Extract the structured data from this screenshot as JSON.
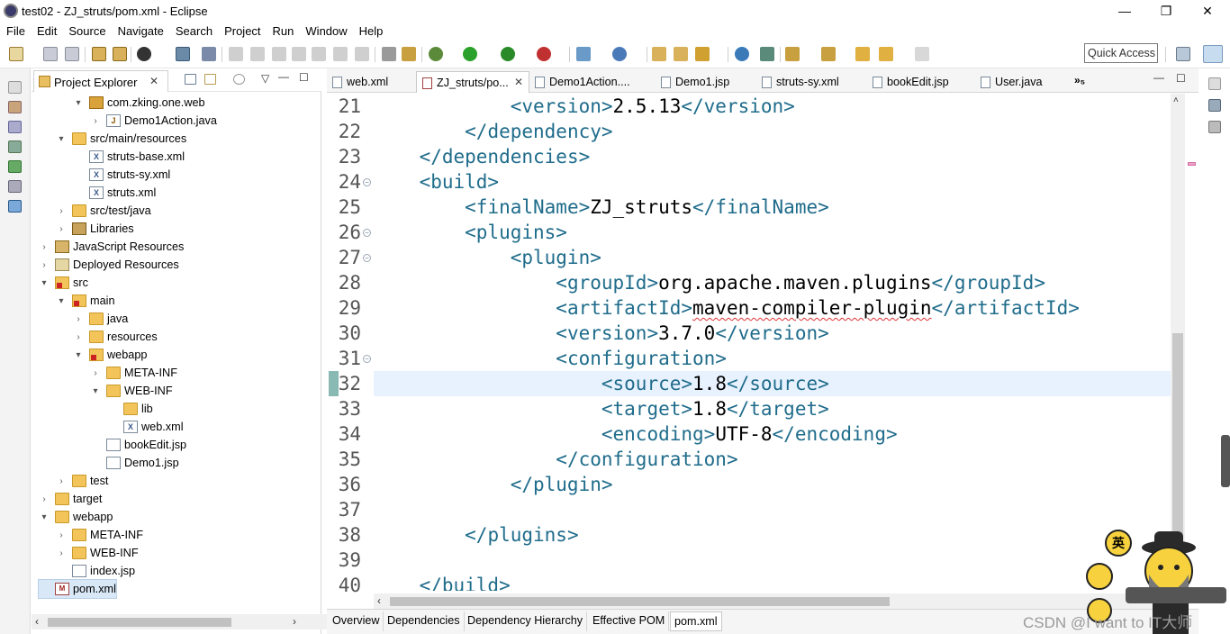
{
  "window": {
    "title": "test02 - ZJ_struts/pom.xml - Eclipse",
    "minimize": "—",
    "maximize": "❐",
    "close": "✕"
  },
  "menu": [
    "File",
    "Edit",
    "Source",
    "Navigate",
    "Search",
    "Project",
    "Run",
    "Window",
    "Help"
  ],
  "toolbar": {
    "quick_access": "Quick Access"
  },
  "project_explorer": {
    "title": "Project Explorer",
    "close": "✕",
    "tree": [
      {
        "label": "com.zking.one.web",
        "icon": "package-icon",
        "depth": 3,
        "arrow": "▾"
      },
      {
        "label": "Demo1Action.java",
        "icon": "java-file-icon",
        "depth": 4,
        "arrow": "›"
      },
      {
        "label": "src/main/resources",
        "icon": "source-folder-icon",
        "depth": 2,
        "arrow": "▾"
      },
      {
        "label": "struts-base.xml",
        "icon": "xml-file-icon",
        "depth": 3,
        "arrow": ""
      },
      {
        "label": "struts-sy.xml",
        "icon": "xml-file-icon",
        "depth": 3,
        "arrow": ""
      },
      {
        "label": "struts.xml",
        "icon": "xml-file-icon",
        "depth": 3,
        "arrow": ""
      },
      {
        "label": "src/test/java",
        "icon": "source-folder-icon",
        "depth": 2,
        "arrow": "›"
      },
      {
        "label": "Libraries",
        "icon": "library-icon",
        "depth": 2,
        "arrow": "›"
      },
      {
        "label": "JavaScript Resources",
        "icon": "javascript-icon",
        "depth": 1,
        "arrow": "›"
      },
      {
        "label": "Deployed Resources",
        "icon": "deployed-icon",
        "depth": 1,
        "arrow": "›"
      },
      {
        "label": "src",
        "icon": "error-folder-icon",
        "depth": 1,
        "arrow": "▾"
      },
      {
        "label": "main",
        "icon": "error-folder-icon",
        "depth": 2,
        "arrow": "▾"
      },
      {
        "label": "java",
        "icon": "folder-icon",
        "depth": 3,
        "arrow": "›"
      },
      {
        "label": "resources",
        "icon": "folder-icon",
        "depth": 3,
        "arrow": "›"
      },
      {
        "label": "webapp",
        "icon": "error-folder-icon",
        "depth": 3,
        "arrow": "▾"
      },
      {
        "label": "META-INF",
        "icon": "folder-icon",
        "depth": 4,
        "arrow": "›"
      },
      {
        "label": "WEB-INF",
        "icon": "folder-icon",
        "depth": 4,
        "arrow": "▾"
      },
      {
        "label": "lib",
        "icon": "folder-icon",
        "depth": 5,
        "arrow": ""
      },
      {
        "label": "web.xml",
        "icon": "xml-file-icon",
        "depth": 5,
        "arrow": ""
      },
      {
        "label": "bookEdit.jsp",
        "icon": "jsp-file-icon",
        "depth": 4,
        "arrow": ""
      },
      {
        "label": "Demo1.jsp",
        "icon": "error-jsp-icon",
        "depth": 4,
        "arrow": ""
      },
      {
        "label": "test",
        "icon": "folder-icon",
        "depth": 2,
        "arrow": "›"
      },
      {
        "label": "target",
        "icon": "folder-icon",
        "depth": 1,
        "arrow": "›"
      },
      {
        "label": "webapp",
        "icon": "folder-icon",
        "depth": 1,
        "arrow": "▾"
      },
      {
        "label": "META-INF",
        "icon": "folder-icon",
        "depth": 2,
        "arrow": "›"
      },
      {
        "label": "WEB-INF",
        "icon": "folder-icon",
        "depth": 2,
        "arrow": "›"
      },
      {
        "label": "index.jsp",
        "icon": "jsp-file-icon",
        "depth": 2,
        "arrow": ""
      },
      {
        "label": "pom.xml",
        "icon": "pom-file-icon",
        "depth": 1,
        "arrow": "",
        "selected": true
      }
    ]
  },
  "editor": {
    "tabs": [
      {
        "label": "web.xml",
        "active": false
      },
      {
        "label": "ZJ_struts/po...",
        "active": true,
        "close": "✕"
      },
      {
        "label": "Demo1Action....",
        "active": false
      },
      {
        "label": "Demo1.jsp",
        "active": false
      },
      {
        "label": "struts-sy.xml",
        "active": false
      },
      {
        "label": "bookEdit.jsp",
        "active": false
      },
      {
        "label": "User.java",
        "active": false
      }
    ],
    "more_tabs": "»₅",
    "lines": [
      {
        "no": "21",
        "text": "            <version>2.5.13</version>",
        "fold": ""
      },
      {
        "no": "22",
        "text": "        </dependency>",
        "fold": ""
      },
      {
        "no": "23",
        "text": "    </dependencies>",
        "fold": ""
      },
      {
        "no": "24",
        "text": "    <build>",
        "fold": "⊖"
      },
      {
        "no": "25",
        "text": "        <finalName>ZJ_struts</finalName>",
        "fold": ""
      },
      {
        "no": "26",
        "text": "        <plugins>",
        "fold": "⊖"
      },
      {
        "no": "27",
        "text": "            <plugin>",
        "fold": "⊖"
      },
      {
        "no": "28",
        "text": "                <groupId>org.apache.maven.plugins</groupId>",
        "fold": ""
      },
      {
        "no": "29",
        "text": "                <artifactId>maven-compiler-plugin</artifactId>",
        "fold": ""
      },
      {
        "no": "30",
        "text": "                <version>3.7.0</version>",
        "fold": ""
      },
      {
        "no": "31",
        "text": "                <configuration>",
        "fold": "⊖"
      },
      {
        "no": "32",
        "text": "                    <source>1.8</source>",
        "fold": "",
        "highlight": true
      },
      {
        "no": "33",
        "text": "                    <target>1.8</target>",
        "fold": ""
      },
      {
        "no": "34",
        "text": "                    <encoding>UTF-8</encoding>",
        "fold": ""
      },
      {
        "no": "35",
        "text": "                </configuration>",
        "fold": ""
      },
      {
        "no": "36",
        "text": "            </plugin>",
        "fold": ""
      },
      {
        "no": "37",
        "text": "",
        "fold": ""
      },
      {
        "no": "38",
        "text": "        </plugins>",
        "fold": ""
      },
      {
        "no": "39",
        "text": "",
        "fold": ""
      },
      {
        "no": "40",
        "text": "    </build>",
        "fold": ""
      }
    ],
    "bottom_tabs": [
      "Overview",
      "Dependencies",
      "Dependency Hierarchy",
      "Effective POM",
      "pom.xml"
    ],
    "active_bottom_tab": "pom.xml"
  },
  "overlay": {
    "watermark": "CSDN @I want to IT大师",
    "badge": "英"
  },
  "colors": {
    "tag": "#1f6c8b",
    "highlight_line": "#e8f2fe",
    "selection": "#cce8ff"
  }
}
